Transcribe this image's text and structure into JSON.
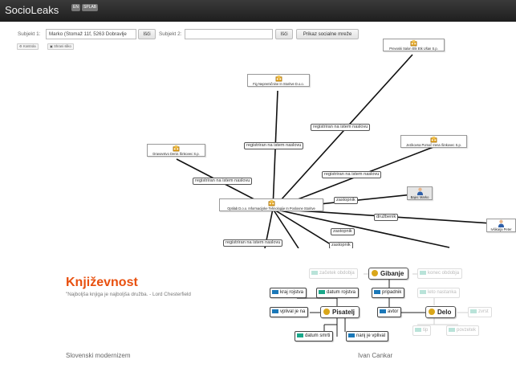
{
  "app": {
    "title": "SocioLeaks",
    "languages": [
      "EN",
      "SPLAB"
    ]
  },
  "search": {
    "subject1_label": "Subjekt 1:",
    "subject1_value": "Marko (Stomaž 11f, 5263 Dobravlje",
    "search_label": "Išči",
    "subject2_label": "Subjekt 2:",
    "subject2_value": "",
    "search2_label": "Išči",
    "social_label": "Prikaz socialne mreže",
    "control_label": "Kontrola",
    "save_image_label": "Shrani sliko"
  },
  "graph": {
    "nodes": {
      "n1": "Prevoski Salon Etk Etk Ušan S.p.",
      "n2": "Fig Nepremičnine In Storitve D.o.o.",
      "n3": "Dravovstvo Denis Šinkovec S.p.",
      "n4": "Jezikovna Pomoč Irena Šinkovec S.p.",
      "n5": "Optilab D.o.o. Informacijske Tehnologije In Poslovne Storitve",
      "n6": "Bajec Marko",
      "n7": "Ivšikarja Peter"
    },
    "edges": {
      "e1": "registriran na istem naslovu",
      "e2": "registriran na istem naslovu",
      "e3": "registriran na istem naslovu",
      "e4": "registriran na istem naslovu",
      "e5": "zastopnik",
      "e6": "družbenik",
      "e7": "zastopnik",
      "e8": "registriran na istem naslovu",
      "e9": "zastopnik"
    }
  },
  "slide": {
    "title": "Književnost",
    "quote": "\"Najboljša knjiga je najboljša družba. - Lord Chesterfield",
    "footer_left": "Slovenski modernizem",
    "footer_right": "Ivan Cankar",
    "concepts": {
      "zacetek": "začetek obdobja",
      "gibanje": "Gibanje",
      "konec": "konec obdobja",
      "kraj": "kraj rojstva",
      "datum": "datum rojstva",
      "pripadnik": "pripadnik",
      "leto": "leto nastanka",
      "vplival": "vplival je na",
      "pisatelj": "Pisatelj",
      "avtor": "avtor",
      "delo": "Delo",
      "zvrst": "zvrst",
      "smrt": "datum smrti",
      "nanj": "nanj je vplival",
      "tip": "tip",
      "povzetek": "povzetek"
    },
    "colors": {
      "teal": "#1aa88a",
      "blue": "#1b78b8",
      "gold": "#d9a619",
      "orange": "#e8500f"
    }
  }
}
